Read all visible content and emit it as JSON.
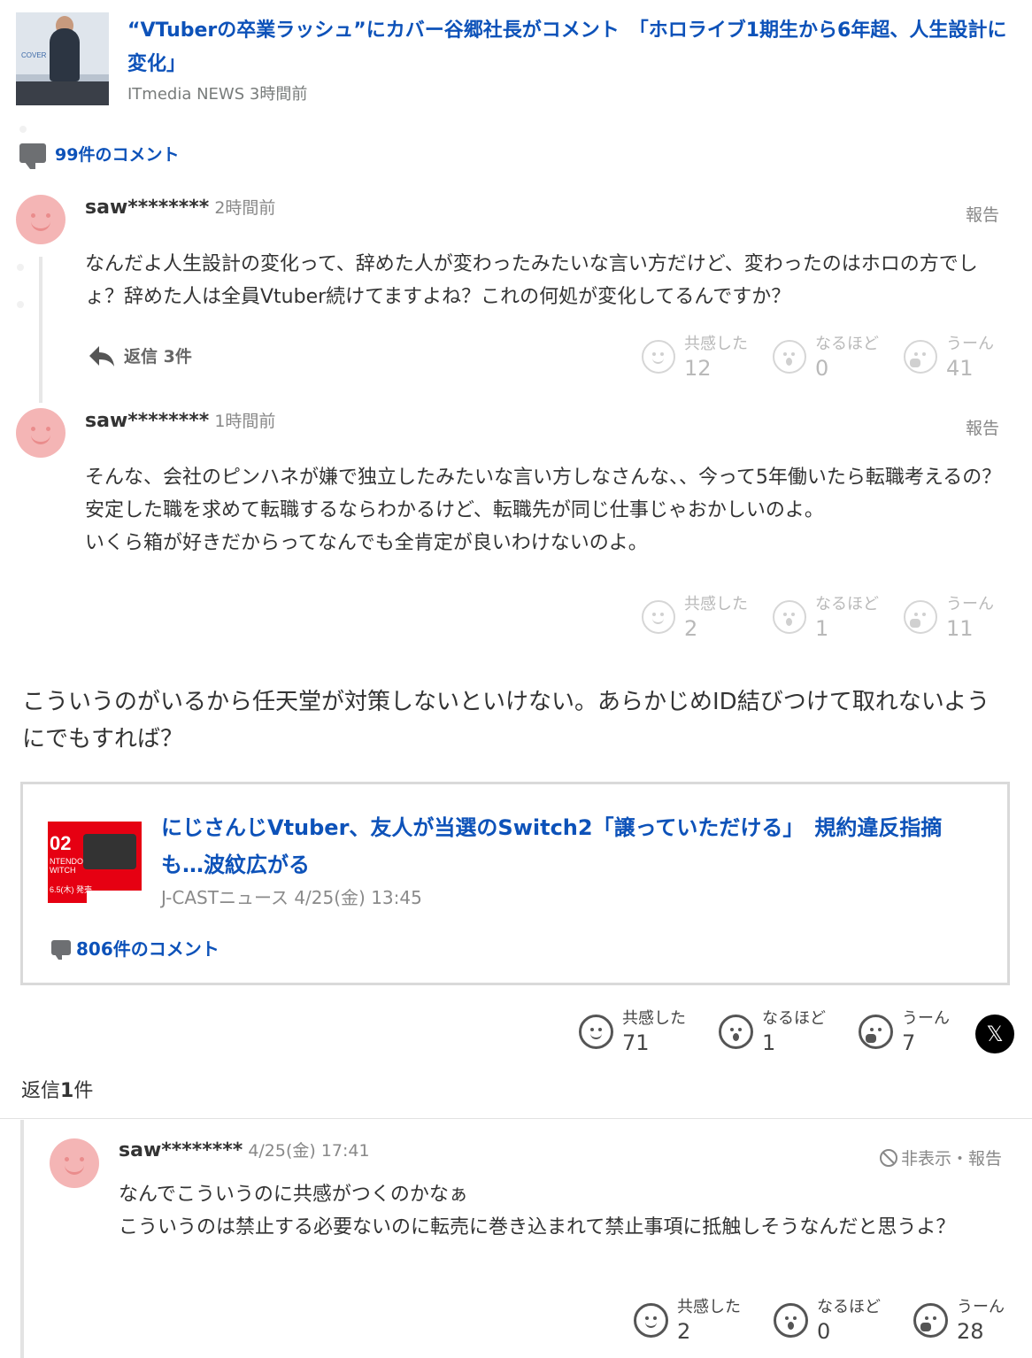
{
  "article": {
    "title": "“VTuberの卒業ラッシュ”にカバー谷郷社長がコメント　「ホロライブ1期生から6年超、人生設計に変化」",
    "source": "ITmedia NEWS 3時間前",
    "thumbnail_logo": "COVER",
    "comment_count_label": "99件のコメント"
  },
  "comments": [
    {
      "user": "saw********",
      "time": "2時間前",
      "report_label": "報告",
      "text": "なんだよ人生設計の変化って、辞めた人が変わったみたいな言い方だけど、変わったのはホロの方でしょ？辞めた人は全員Vtuber続けてますよね？これの何処が変化してるんですか？",
      "reply_label": "返信 3件",
      "reactions": [
        {
          "label": "共感した",
          "count": "12"
        },
        {
          "label": "なるほど",
          "count": "0"
        },
        {
          "label": "うーん",
          "count": "41"
        }
      ]
    },
    {
      "user": "saw********",
      "time": "1時間前",
      "report_label": "報告",
      "text": "そんな、会社のピンハネが嫌で独立したみたいな言い方しなさんな、、今って5年働いたら転職考えるの？安定した職を求めて転職するならわかるけど、転職先が同じ仕事じゃおかしいのよ。\nいくら箱が好きだからってなんでも全肯定が良いわけないのよ。",
      "reactions": [
        {
          "label": "共感した",
          "count": "2"
        },
        {
          "label": "なるほど",
          "count": "1"
        },
        {
          "label": "うーん",
          "count": "11"
        }
      ]
    }
  ],
  "main_comment": {
    "text": "こういうのがいるから任天堂が対策しないといけない。あらかじめID結びつけて取れないようにでもすれば？",
    "linked_article": {
      "title": "にじさんじVtuber、友人が当選のSwitch2「譲っていただける」　規約違反指摘も…波紋広がる",
      "source": "J-CASTニュース 4/25(金) 13:45",
      "comment_count_label": "806件のコメント",
      "thumbnail_text_1": "02",
      "thumbnail_text_2": "NTENDO\nWITCH",
      "thumbnail_text_3": "6.5(木) 発売"
    },
    "reactions": [
      {
        "label": "共感した",
        "count": "71"
      },
      {
        "label": "なるほど",
        "count": "1"
      },
      {
        "label": "うーん",
        "count": "7"
      }
    ],
    "share_x": "𝕏",
    "replies_prefix": "返信",
    "replies_count": "1",
    "replies_suffix": "件"
  },
  "reply": {
    "user": "saw********",
    "time": "4/25(金) 17:41",
    "hide_report_label": "非表示・報告",
    "text": "なんでこういうのに共感がつくのかなぁ\nこういうのは禁止する必要ないのに転売に巻き込まれて禁止事項に抵触しそうなんだと思うよ？",
    "reactions": [
      {
        "label": "共感した",
        "count": "2"
      },
      {
        "label": "なるほど",
        "count": "0"
      },
      {
        "label": "うーん",
        "count": "28"
      }
    ]
  }
}
